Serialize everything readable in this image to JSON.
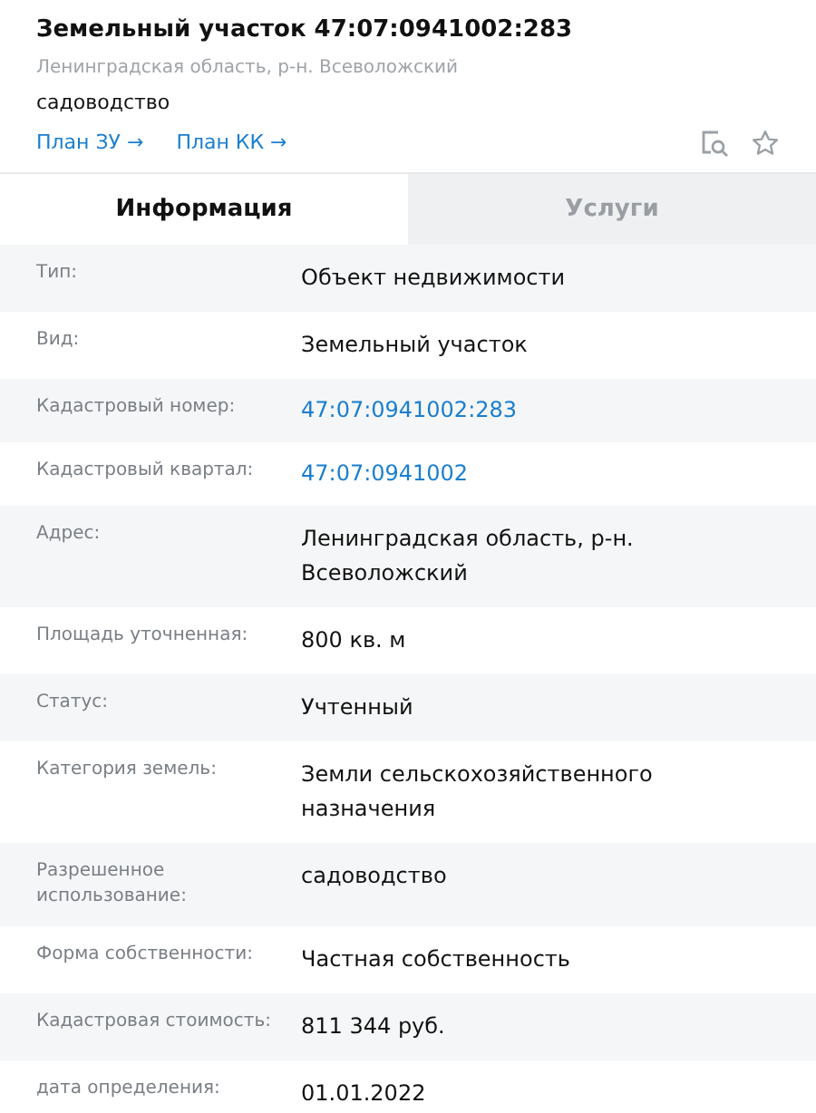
{
  "header": {
    "title": "Земельный участок 47:07:0941002:283",
    "address": "Ленинградская область, р-н. Всеволожский",
    "usage": "садоводство",
    "links": [
      {
        "label": "План ЗУ →"
      },
      {
        "label": "План КК →"
      }
    ]
  },
  "tabs": [
    {
      "label": "Информация",
      "selected": true
    },
    {
      "label": "Услуги",
      "selected": false
    }
  ],
  "rows": [
    {
      "label": "Тип:",
      "value": "Объект недвижимости",
      "kind": "text"
    },
    {
      "label": "Вид:",
      "value": "Земельный участок",
      "kind": "text"
    },
    {
      "label": "Кадастровый номер:",
      "value": "47:07:0941002:283",
      "kind": "link"
    },
    {
      "label": "Кадастровый квартал:",
      "value": "47:07:0941002",
      "kind": "link"
    },
    {
      "label": "Адрес:",
      "value": "Ленинградская область, р-н. Всеволожский",
      "kind": "text"
    },
    {
      "label": "Площадь уточненная:",
      "value": "800 кв. м",
      "kind": "text"
    },
    {
      "label": "Статус:",
      "value": "Учтенный",
      "kind": "text"
    },
    {
      "label": "Категория земель:",
      "value": "Земли сельскохозяйственного назначения",
      "kind": "text"
    },
    {
      "label": "Разрешенное использование:",
      "value": "садоводство",
      "kind": "text"
    },
    {
      "label": "Форма собственности:",
      "value": "Частная собственность",
      "kind": "text"
    },
    {
      "label": "Кадастровая стоимость:",
      "value": "811 344 руб.",
      "kind": "text"
    },
    {
      "label": "дата определения:",
      "value": "01.01.2022",
      "kind": "text"
    }
  ]
}
